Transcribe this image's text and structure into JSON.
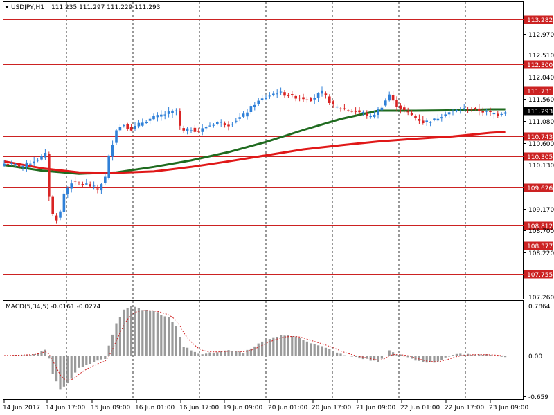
{
  "chart_header": {
    "symbol_label": "USDJPY,H1",
    "ohlc": "111.235 111.297 111.229 111.293"
  },
  "macd_header": {
    "label": "MACD(5,34,5)",
    "values": "-0.0161 -0.0274"
  },
  "colors": {
    "bull_candle": "#2f80d8",
    "bear_candle": "#d92424",
    "ma_fast": "#1f6b1f",
    "ma_slow": "#e01818",
    "level_line": "#cc2222",
    "macd_hist": "#9a9a9a",
    "macd_signal": "#d02020",
    "grid": "#000000"
  },
  "chart_data": [
    {
      "type": "candlestick",
      "title": "USDJPY,H1",
      "price_axis_ticks": [
        "112.970",
        "112.510",
        "112.040",
        "111.560",
        "111.080",
        "110.600",
        "110.130",
        "109.170",
        "108.700",
        "108.220",
        "107.260"
      ],
      "ylim": [
        107.26,
        113.36
      ],
      "time_axis_labels": [
        "14 Jun 2017",
        "14 Jun 17:00",
        "15 Jun 09:00",
        "16 Jun 01:00",
        "16 Jun 17:00",
        "19 Jun 09:00",
        "20 Jun 01:00",
        "20 Jun 17:00",
        "21 Jun 09:00",
        "22 Jun 01:00",
        "22 Jun 17:00",
        "23 Jun 09:00"
      ],
      "horizontal_levels": [
        "113.282",
        "112.300",
        "111.731",
        "110.743",
        "110.305",
        "109.626",
        "108.812",
        "108.377",
        "107.755"
      ],
      "current_price": "111.293",
      "close_path": [
        {
          "i": 0,
          "c": 110.15
        },
        {
          "i": 5,
          "c": 110.1
        },
        {
          "i": 9,
          "c": 110.25
        },
        {
          "i": 11,
          "c": 110.35
        },
        {
          "i": 12,
          "c": 109.45
        },
        {
          "i": 13,
          "c": 109.05
        },
        {
          "i": 14,
          "c": 108.95
        },
        {
          "i": 15,
          "c": 109.1
        },
        {
          "i": 16,
          "c": 109.5
        },
        {
          "i": 18,
          "c": 109.75
        },
        {
          "i": 22,
          "c": 109.7
        },
        {
          "i": 25,
          "c": 109.6
        },
        {
          "i": 27,
          "c": 109.85
        },
        {
          "i": 28,
          "c": 110.3
        },
        {
          "i": 30,
          "c": 110.9
        },
        {
          "i": 32,
          "c": 111.0
        },
        {
          "i": 34,
          "c": 110.9
        },
        {
          "i": 37,
          "c": 111.05
        },
        {
          "i": 40,
          "c": 111.15
        },
        {
          "i": 44,
          "c": 111.25
        },
        {
          "i": 46,
          "c": 111.3
        },
        {
          "i": 47,
          "c": 110.95
        },
        {
          "i": 48,
          "c": 110.85
        },
        {
          "i": 50,
          "c": 110.9
        },
        {
          "i": 52,
          "c": 110.85
        },
        {
          "i": 54,
          "c": 110.95
        },
        {
          "i": 57,
          "c": 111.05
        },
        {
          "i": 60,
          "c": 111.0
        },
        {
          "i": 64,
          "c": 111.2
        },
        {
          "i": 67,
          "c": 111.45
        },
        {
          "i": 70,
          "c": 111.6
        },
        {
          "i": 73,
          "c": 111.7
        },
        {
          "i": 78,
          "c": 111.6
        },
        {
          "i": 82,
          "c": 111.55
        },
        {
          "i": 85,
          "c": 111.7
        },
        {
          "i": 88,
          "c": 111.4
        },
        {
          "i": 90,
          "c": 111.35
        },
        {
          "i": 93,
          "c": 111.3
        },
        {
          "i": 96,
          "c": 111.25
        },
        {
          "i": 98,
          "c": 111.15
        },
        {
          "i": 101,
          "c": 111.4
        },
        {
          "i": 103,
          "c": 111.65
        },
        {
          "i": 104,
          "c": 111.5
        },
        {
          "i": 106,
          "c": 111.35
        },
        {
          "i": 108,
          "c": 111.25
        },
        {
          "i": 110,
          "c": 111.15
        },
        {
          "i": 112,
          "c": 111.05
        },
        {
          "i": 115,
          "c": 111.1
        },
        {
          "i": 118,
          "c": 111.25
        },
        {
          "i": 121,
          "c": 111.3
        },
        {
          "i": 124,
          "c": 111.35
        },
        {
          "i": 127,
          "c": 111.3
        },
        {
          "i": 130,
          "c": 111.25
        },
        {
          "i": 132,
          "c": 111.22
        },
        {
          "i": 134,
          "c": 111.29
        }
      ],
      "series": [
        {
          "name": "",
          "key": "ma_fast",
          "x": [
            0,
            10,
            20,
            30,
            40,
            50,
            60,
            70,
            80,
            90,
            100,
            110,
            120,
            130,
            134
          ],
          "values": [
            110.12,
            110.0,
            109.93,
            109.96,
            110.08,
            110.22,
            110.4,
            110.62,
            110.88,
            111.12,
            111.3,
            111.3,
            111.31,
            111.33,
            111.33
          ]
        },
        {
          "name": "",
          "key": "ma_slow",
          "x": [
            0,
            10,
            20,
            30,
            40,
            50,
            60,
            70,
            80,
            90,
            100,
            110,
            120,
            130,
            134
          ],
          "values": [
            110.2,
            110.05,
            109.96,
            109.95,
            109.98,
            110.08,
            110.2,
            110.33,
            110.46,
            110.55,
            110.63,
            110.69,
            110.74,
            110.82,
            110.84
          ]
        }
      ]
    },
    {
      "type": "bar",
      "title": "MACD(5,34,5)",
      "axis_ticks": [
        "0.7864",
        "0.00",
        "-0.659"
      ],
      "ylim": [
        -0.659,
        0.7864
      ],
      "histogram_path": [
        {
          "i": 0,
          "v": 0.0
        },
        {
          "i": 8,
          "v": 0.02
        },
        {
          "i": 11,
          "v": 0.1
        },
        {
          "i": 12,
          "v": -0.05
        },
        {
          "i": 13,
          "v": -0.3
        },
        {
          "i": 15,
          "v": -0.55
        },
        {
          "i": 17,
          "v": -0.45
        },
        {
          "i": 20,
          "v": -0.2
        },
        {
          "i": 24,
          "v": -0.1
        },
        {
          "i": 27,
          "v": -0.05
        },
        {
          "i": 28,
          "v": 0.15
        },
        {
          "i": 30,
          "v": 0.5
        },
        {
          "i": 32,
          "v": 0.72
        },
        {
          "i": 34,
          "v": 0.78
        },
        {
          "i": 37,
          "v": 0.72
        },
        {
          "i": 40,
          "v": 0.7
        },
        {
          "i": 44,
          "v": 0.6
        },
        {
          "i": 46,
          "v": 0.45
        },
        {
          "i": 48,
          "v": 0.15
        },
        {
          "i": 52,
          "v": 0.02
        },
        {
          "i": 56,
          "v": 0.05
        },
        {
          "i": 60,
          "v": 0.08
        },
        {
          "i": 64,
          "v": 0.05
        },
        {
          "i": 67,
          "v": 0.15
        },
        {
          "i": 70,
          "v": 0.25
        },
        {
          "i": 74,
          "v": 0.32
        },
        {
          "i": 78,
          "v": 0.3
        },
        {
          "i": 82,
          "v": 0.2
        },
        {
          "i": 85,
          "v": 0.15
        },
        {
          "i": 88,
          "v": 0.08
        },
        {
          "i": 90,
          "v": 0.02
        },
        {
          "i": 93,
          "v": -0.02
        },
        {
          "i": 96,
          "v": -0.05
        },
        {
          "i": 100,
          "v": -0.1
        },
        {
          "i": 102,
          "v": 0.0
        },
        {
          "i": 103,
          "v": 0.08
        },
        {
          "i": 105,
          "v": 0.02
        },
        {
          "i": 108,
          "v": -0.02
        },
        {
          "i": 110,
          "v": -0.08
        },
        {
          "i": 113,
          "v": -0.12
        },
        {
          "i": 116,
          "v": -0.1
        },
        {
          "i": 118,
          "v": -0.04
        },
        {
          "i": 121,
          "v": 0.02
        },
        {
          "i": 125,
          "v": 0.02
        },
        {
          "i": 130,
          "v": 0.01
        },
        {
          "i": 134,
          "v": -0.02
        }
      ]
    }
  ]
}
